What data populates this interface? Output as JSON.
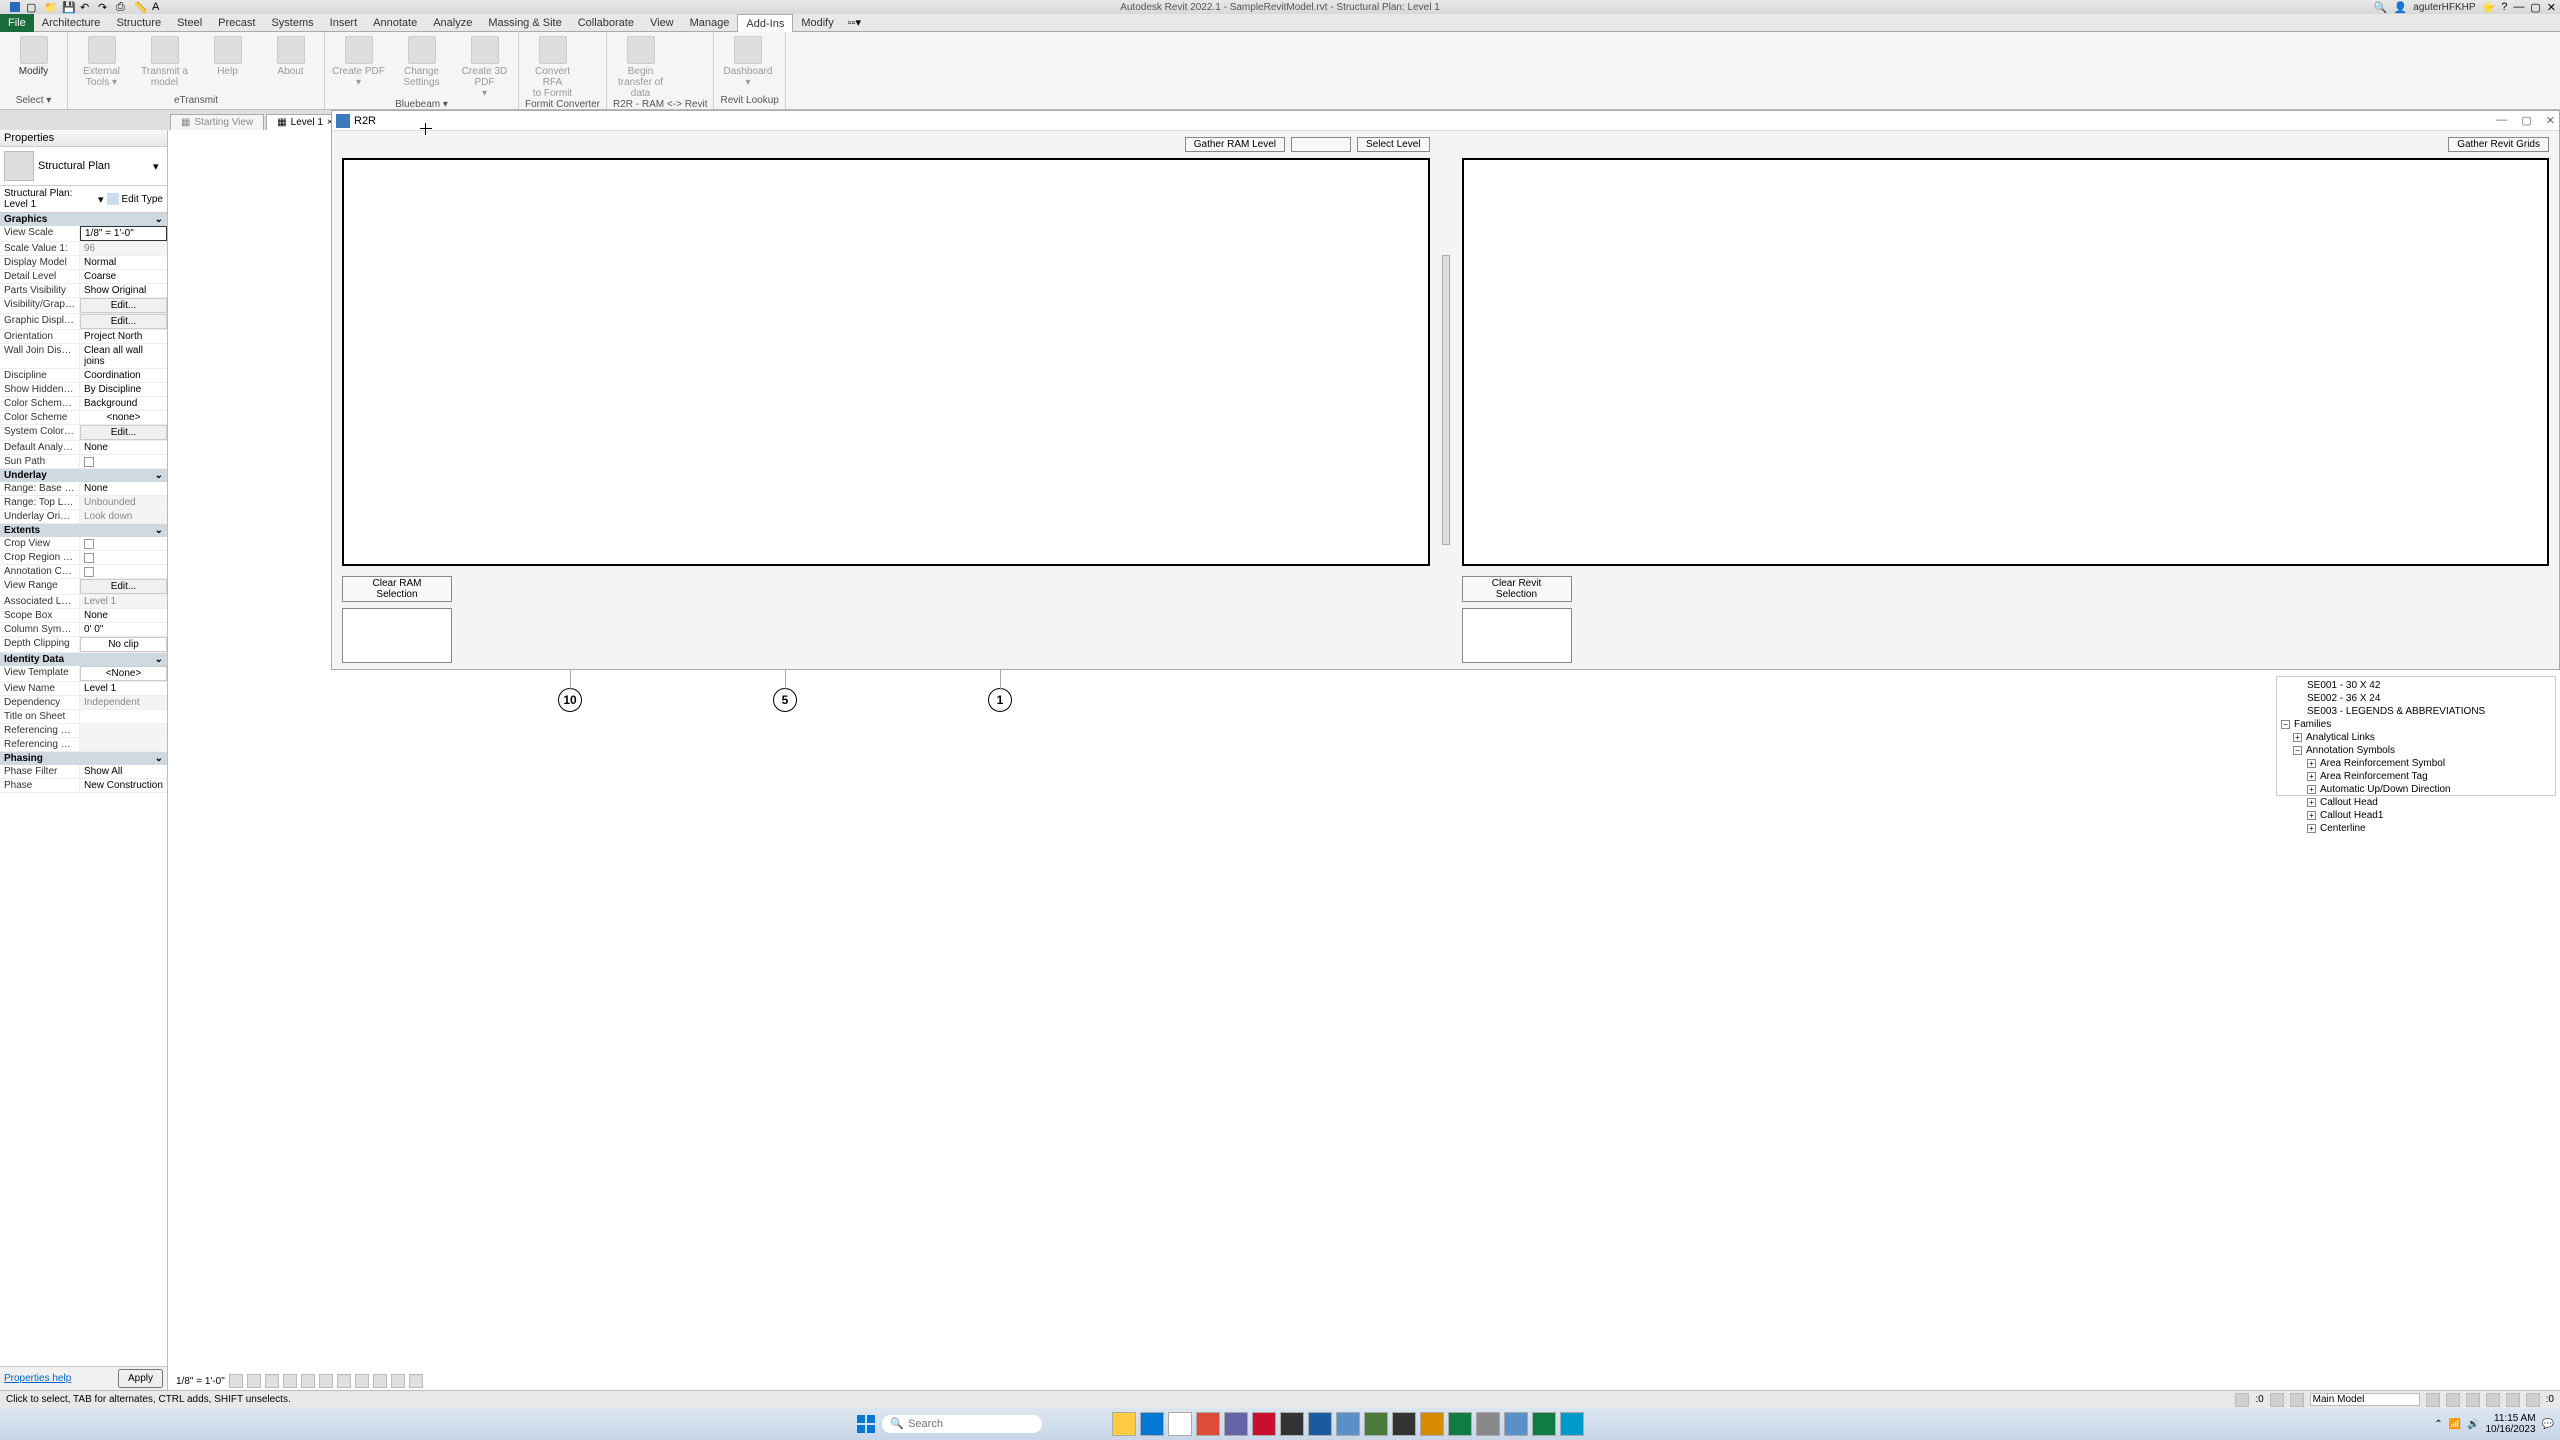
{
  "titlebar": {
    "title": "Autodesk Revit 2022.1 - SampleRevitModel.rvt - Structural Plan: Level 1",
    "user": "aguterHFKHP"
  },
  "ribbon": {
    "file": "File",
    "tabs": [
      "Architecture",
      "Structure",
      "Steel",
      "Precast",
      "Systems",
      "Insert",
      "Annotate",
      "Analyze",
      "Massing & Site",
      "Collaborate",
      "View",
      "Manage",
      "Add-Ins",
      "Modify"
    ],
    "active": "Add-Ins",
    "panels": {
      "select": {
        "modify": "Modify",
        "title": "Select ▾"
      },
      "etransmit": {
        "external": "External\nTools ▾",
        "transmit": "Transmit a model",
        "help": "Help",
        "about": "About",
        "title": "eTransmit"
      },
      "bluebeam": {
        "createpdf": "Create PDF\n▾",
        "change": "Change\nSettings",
        "create3d": "Create 3D PDF\n▾",
        "title": "Bluebeam ▾"
      },
      "formit": {
        "convert": "Convert RFA\nto Formit",
        "title": "Formit Converter"
      },
      "r2r": {
        "begin": "Begin transfer of data",
        "title": "R2R - RAM <-> Revit"
      },
      "lookup": {
        "dash": "Dashboard\n▾",
        "title": "Revit Lookup"
      }
    }
  },
  "doctabs": {
    "starting": "Starting View",
    "level1": "Level 1"
  },
  "properties": {
    "header": "Properties",
    "type": "Structural Plan",
    "instance": "Structural Plan: Level 1",
    "editType": "Edit Type",
    "groups": {
      "graphics": "Graphics",
      "underlay": "Underlay",
      "extents": "Extents",
      "identity": "Identity Data",
      "phasing": "Phasing"
    },
    "rows": {
      "viewScale": {
        "n": "View Scale",
        "v": "1/8\" = 1'-0\""
      },
      "scaleValue": {
        "n": "Scale Value    1:",
        "v": "96"
      },
      "displayModel": {
        "n": "Display Model",
        "v": "Normal"
      },
      "detailLevel": {
        "n": "Detail Level",
        "v": "Coarse"
      },
      "partsVis": {
        "n": "Parts Visibility",
        "v": "Show Original"
      },
      "visGfx": {
        "n": "Visibility/Graphics Over...",
        "v": "Edit..."
      },
      "gfxDisplay": {
        "n": "Graphic Display Options",
        "v": "Edit..."
      },
      "orientation": {
        "n": "Orientation",
        "v": "Project North"
      },
      "wallJoin": {
        "n": "Wall Join Display",
        "v": "Clean all wall joins"
      },
      "discipline": {
        "n": "Discipline",
        "v": "Coordination"
      },
      "hiddenLines": {
        "n": "Show Hidden Lines",
        "v": "By Discipline"
      },
      "colorSchemeLoc": {
        "n": "Color Scheme Location",
        "v": "Background"
      },
      "colorScheme": {
        "n": "Color Scheme",
        "v": "<none>"
      },
      "sysColor": {
        "n": "System Color Schemes",
        "v": "Edit..."
      },
      "defAnalysis": {
        "n": "Default Analysis Displa...",
        "v": "None"
      },
      "sunPath": {
        "n": "Sun Path",
        "v": ""
      },
      "rangeBase": {
        "n": "Range: Base Level",
        "v": "None"
      },
      "rangeTop": {
        "n": "Range: Top Level",
        "v": "Unbounded"
      },
      "underlayOrient": {
        "n": "Underlay Orientation",
        "v": "Look down"
      },
      "cropView": {
        "n": "Crop View",
        "v": ""
      },
      "cropVisible": {
        "n": "Crop Region Visible",
        "v": ""
      },
      "annoCrop": {
        "n": "Annotation Crop",
        "v": ""
      },
      "viewRange": {
        "n": "View Range",
        "v": "Edit..."
      },
      "assocLevel": {
        "n": "Associated Level",
        "v": "Level 1"
      },
      "scopeBox": {
        "n": "Scope Box",
        "v": "None"
      },
      "colSymOff": {
        "n": "Column Symbolic Offset",
        "v": "0'  0\""
      },
      "depthClip": {
        "n": "Depth Clipping",
        "v": "No clip"
      },
      "viewTemplate": {
        "n": "View Template",
        "v": "<None>"
      },
      "viewName": {
        "n": "View Name",
        "v": "Level 1"
      },
      "dependency": {
        "n": "Dependency",
        "v": "Independent"
      },
      "titleSheet": {
        "n": "Title on Sheet",
        "v": ""
      },
      "refSheet": {
        "n": "Referencing Sheet",
        "v": ""
      },
      "refDetail": {
        "n": "Referencing Detail",
        "v": ""
      },
      "phaseFilter": {
        "n": "Phase Filter",
        "v": "Show All"
      },
      "phase": {
        "n": "Phase",
        "v": "New Construction"
      }
    },
    "help": "Properties help",
    "apply": "Apply"
  },
  "r2r": {
    "title": "R2R",
    "gatherRam": "Gather RAM Level",
    "selectLevel": "Select Level",
    "gatherRevit": "Gather Revit Grids",
    "clearRam": "Clear RAM Selection",
    "clearRevit": "Clear Revit Selection"
  },
  "grids": {
    "a": "10",
    "b": "5",
    "c": "1"
  },
  "tree": {
    "n1": "SE001 - 30 X 42",
    "n2": "SE002 - 36 X 24",
    "n3": "SE003 - LEGENDS & ABBREVIATIONS",
    "families": "Families",
    "analytical": "Analytical Links",
    "annotation": "Annotation Symbols",
    "areaReinfSym": "Area Reinforcement Symbol",
    "areaReinfTag": "Area Reinforcement Tag",
    "autoUpDown": "Automatic Up/Down Direction",
    "callout": "Callout Head",
    "callout1": "Callout Head1",
    "centerline": "Centerline"
  },
  "viewControls": {
    "scale": "1/8\" = 1'-0\""
  },
  "statusbar": {
    "hint": "Click to select, TAB for alternates, CTRL adds, SHIFT unselects.",
    "zero": ":0",
    "mainModel": "Main Model"
  },
  "taskbar": {
    "search": "Search",
    "time": "11:15 AM",
    "date": "10/16/2023"
  }
}
